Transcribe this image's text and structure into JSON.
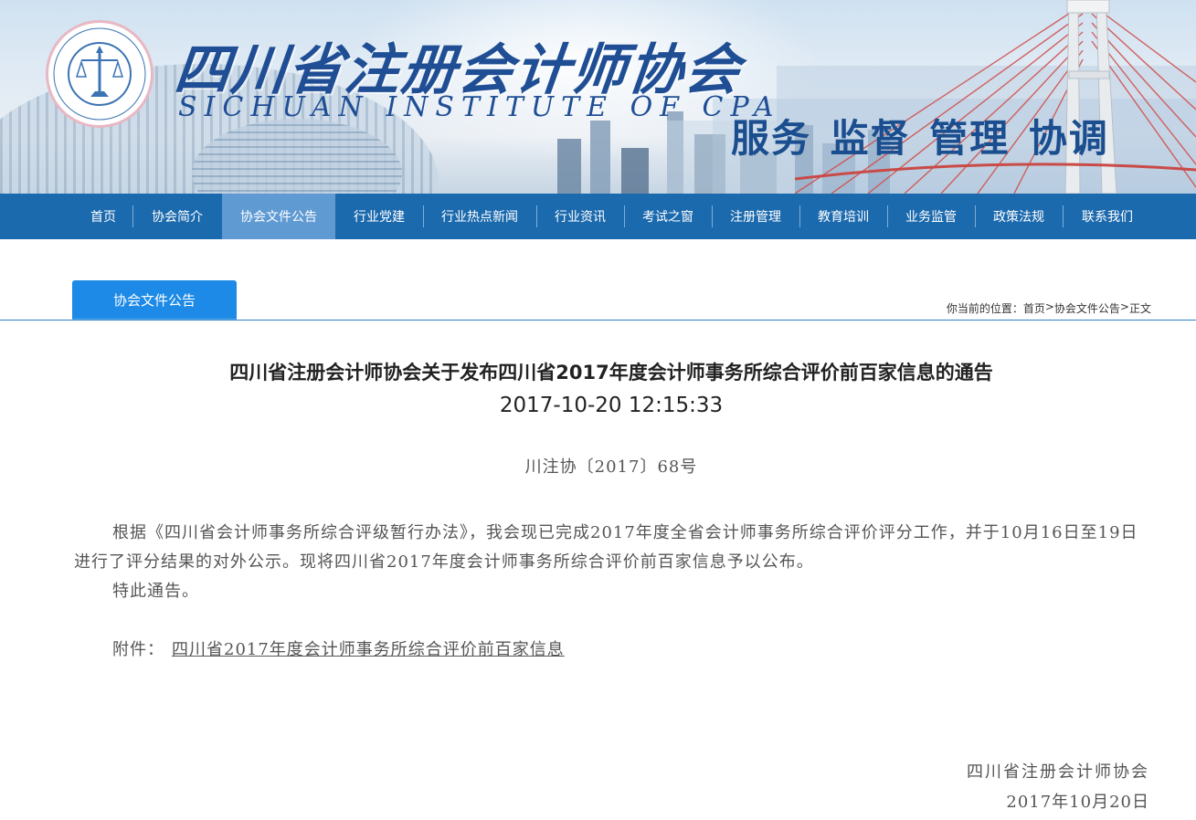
{
  "header": {
    "org_name_cn": "四川省注册会计师协会",
    "org_name_en": "SICHUAN INSTITUTE OF CPA",
    "slogan": "服务 监督 管理 协调"
  },
  "nav": {
    "items": [
      {
        "label": "首页"
      },
      {
        "label": "协会简介"
      },
      {
        "label": "协会文件公告",
        "active": true
      },
      {
        "label": "行业党建"
      },
      {
        "label": "行业热点新闻"
      },
      {
        "label": "行业资讯"
      },
      {
        "label": "考试之窗"
      },
      {
        "label": "注册管理"
      },
      {
        "label": "教育培训"
      },
      {
        "label": "业务监管"
      },
      {
        "label": "政策法规"
      },
      {
        "label": "联系我们"
      }
    ]
  },
  "section": {
    "tab_label": "协会文件公告",
    "breadcrumb": {
      "prefix": "你当前的位置：",
      "items": [
        "首页",
        "协会文件公告",
        "正文"
      ],
      "separator": ">"
    }
  },
  "article": {
    "title": "四川省注册会计师协会关于发布四川省2017年度会计师事务所综合评价前百家信息的通告",
    "datetime": "2017-10-20 12:15:33",
    "doc_number": "川注协〔2017〕68号",
    "paragraph1": "根据《四川省会计师事务所综合评级暂行办法》，我会现已完成2017年度全省会计师事务所综合评价评分工作，并于10月16日至19日进行了评分结果的对外公示。现将四川省2017年度会计师事务所综合评价前百家信息予以公布。",
    "paragraph2": "特此通告。",
    "attachment_label": "附件：",
    "attachment_link": "四川省2017年度会计师事务所综合评价前百家信息",
    "signature_org": "四川省注册会计师协会",
    "signature_date": "2017年10月20日"
  },
  "colors": {
    "nav_bg": "#1c6aae",
    "nav_active": "#5f9ad3",
    "tab_bg": "#1c8ae6",
    "brand_blue": "#1f4e95"
  }
}
